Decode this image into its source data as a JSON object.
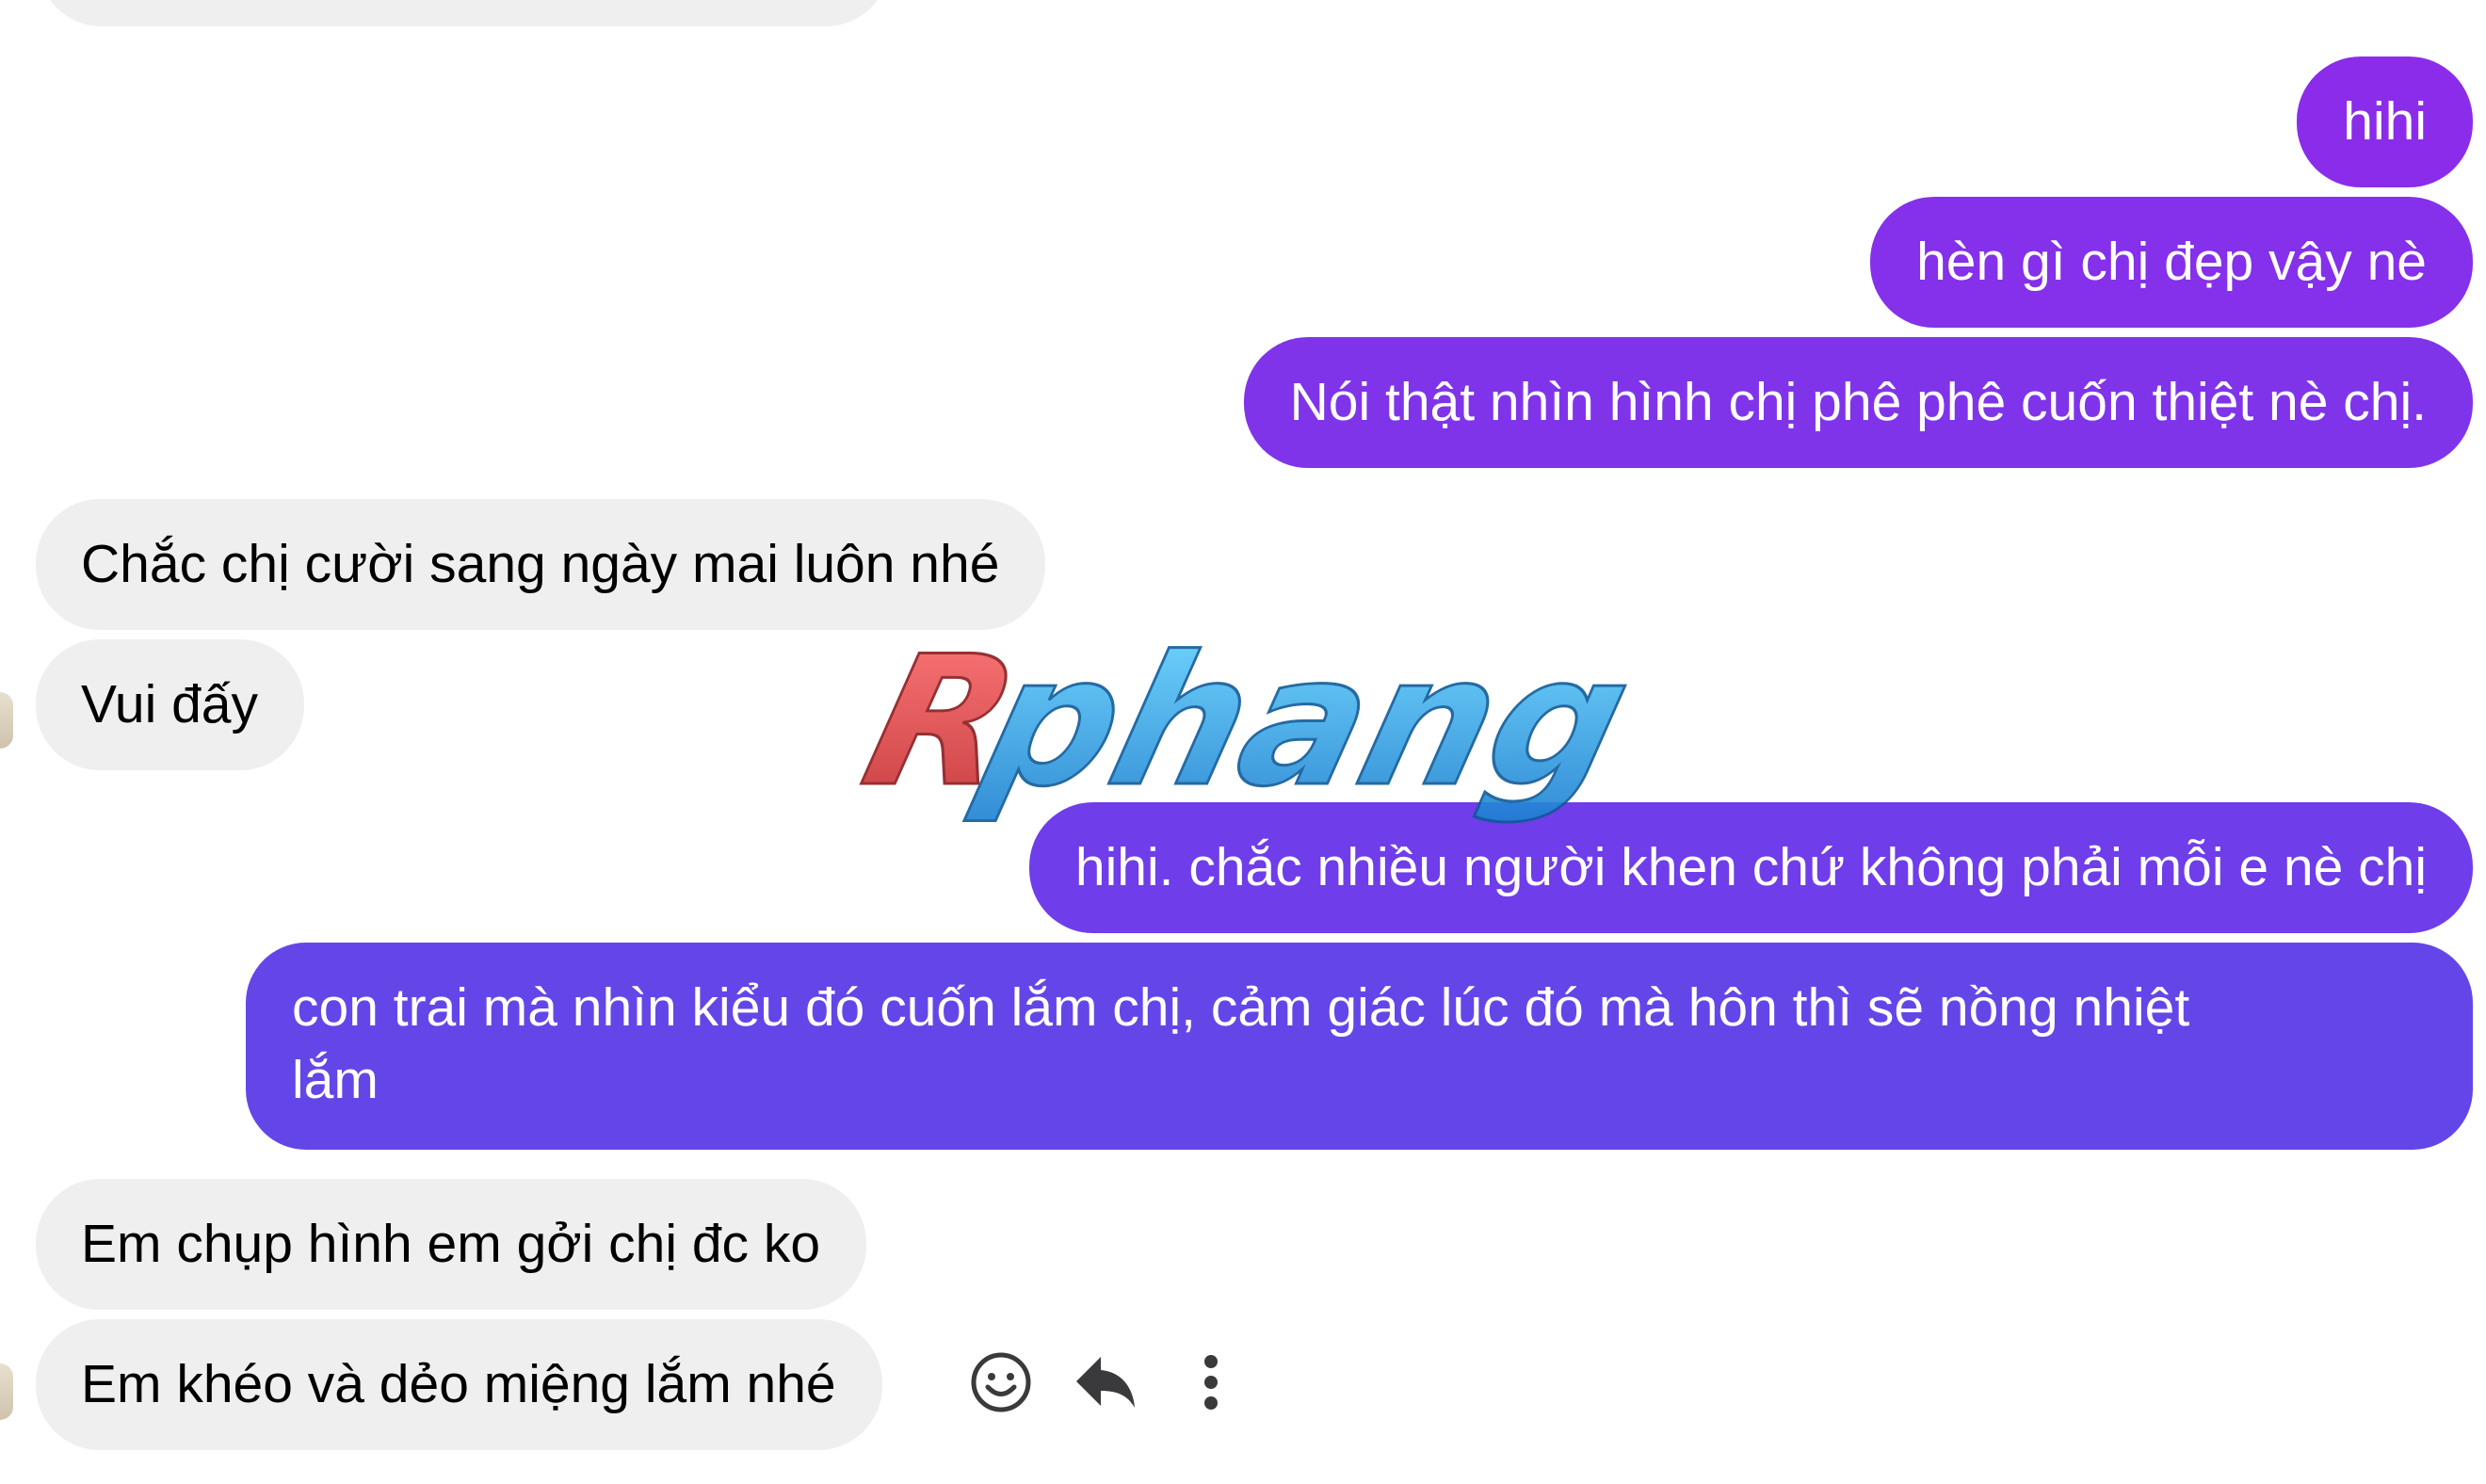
{
  "colors": {
    "incoming_bubble": "#efefef",
    "outgoing_gradient_top": "#8a2cea",
    "outgoing_gradient_bottom": "#5a4ae6",
    "icon": "#3a3a3c"
  },
  "messages": [
    {
      "direction": "outgoing",
      "text": "hihi"
    },
    {
      "direction": "outgoing",
      "text": "hèn gì chị đẹp vậy nè"
    },
    {
      "direction": "outgoing",
      "text": "Nói thật nhìn hình chị phê phê cuốn thiệt nè chị."
    },
    {
      "direction": "incoming",
      "text": "Chắc chị cười sang ngày mai luôn nhé"
    },
    {
      "direction": "incoming",
      "text": "Vui đấy"
    },
    {
      "direction": "outgoing",
      "text": "hihi. chắc nhiều người khen chứ không phải mỗi e nè chị"
    },
    {
      "direction": "outgoing",
      "text_line1": "con trai mà nhìn kiểu đó cuốn lắm chị, cảm giác lúc đó mà hôn thì sẽ nồng nhiệt",
      "text_line2": "lắm"
    },
    {
      "direction": "incoming",
      "text": "Em chụp hình em gởi chị đc ko"
    },
    {
      "direction": "incoming",
      "text": "Em khéo và dẻo miệng lắm nhé"
    }
  ],
  "message_actions": [
    {
      "icon": "smiley-icon"
    },
    {
      "icon": "reply-icon"
    },
    {
      "icon": "more-vertical-icon"
    }
  ],
  "watermark": {
    "text": "Rphang"
  }
}
